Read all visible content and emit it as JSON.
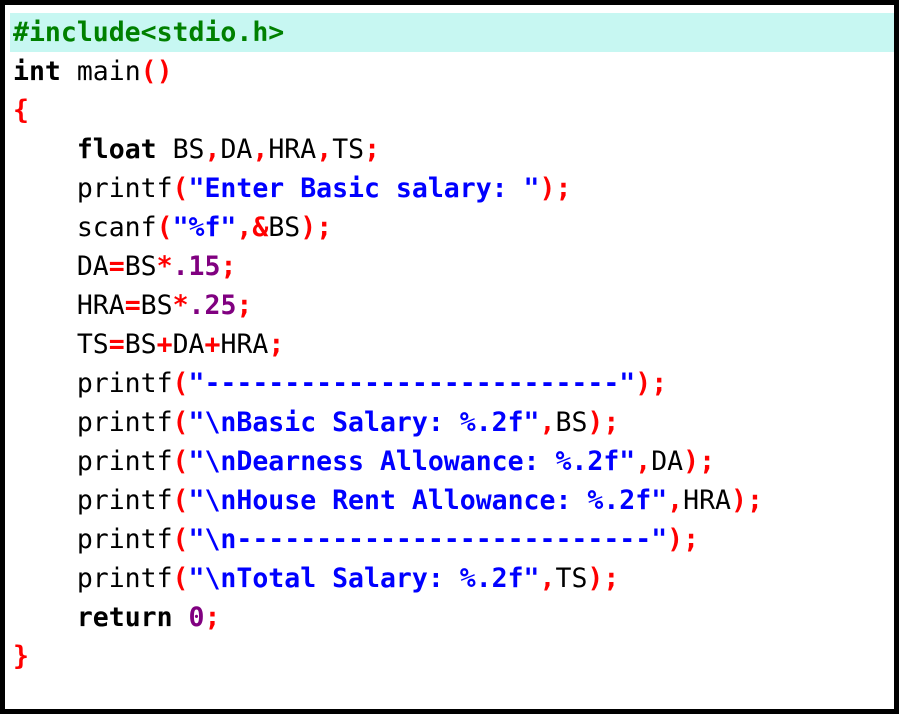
{
  "colors": {
    "plain": "#000000",
    "keyword": "#000000",
    "punct": "#ff0000",
    "string": "#0000ff",
    "number": "#800080",
    "preproc": "#008000",
    "highlight": "#c7f7f2"
  },
  "editor": {
    "highlighted_line": 0,
    "lines": [
      [
        {
          "t": "#include<stdio.h>",
          "k": "preproc"
        }
      ],
      [
        {
          "t": "int",
          "k": "keyword"
        },
        {
          "t": " main",
          "k": "plain"
        },
        {
          "t": "()",
          "k": "punct"
        }
      ],
      [
        {
          "t": "{",
          "k": "punct"
        }
      ],
      [
        {
          "t": "    ",
          "k": "plain"
        },
        {
          "t": "float",
          "k": "keyword"
        },
        {
          "t": " BS",
          "k": "plain"
        },
        {
          "t": ",",
          "k": "punct"
        },
        {
          "t": "DA",
          "k": "plain"
        },
        {
          "t": ",",
          "k": "punct"
        },
        {
          "t": "HRA",
          "k": "plain"
        },
        {
          "t": ",",
          "k": "punct"
        },
        {
          "t": "TS",
          "k": "plain"
        },
        {
          "t": ";",
          "k": "punct"
        }
      ],
      [
        {
          "t": "    printf",
          "k": "plain"
        },
        {
          "t": "(",
          "k": "punct"
        },
        {
          "t": "\"Enter Basic salary: \"",
          "k": "string"
        },
        {
          "t": ");",
          "k": "punct"
        }
      ],
      [
        {
          "t": "    scanf",
          "k": "plain"
        },
        {
          "t": "(",
          "k": "punct"
        },
        {
          "t": "\"%f\"",
          "k": "string"
        },
        {
          "t": ",&",
          "k": "punct"
        },
        {
          "t": "BS",
          "k": "plain"
        },
        {
          "t": ");",
          "k": "punct"
        }
      ],
      [
        {
          "t": "    DA",
          "k": "plain"
        },
        {
          "t": "=",
          "k": "punct"
        },
        {
          "t": "BS",
          "k": "plain"
        },
        {
          "t": "*",
          "k": "punct"
        },
        {
          "t": ".15",
          "k": "number"
        },
        {
          "t": ";",
          "k": "punct"
        }
      ],
      [
        {
          "t": "    HRA",
          "k": "plain"
        },
        {
          "t": "=",
          "k": "punct"
        },
        {
          "t": "BS",
          "k": "plain"
        },
        {
          "t": "*",
          "k": "punct"
        },
        {
          "t": ".25",
          "k": "number"
        },
        {
          "t": ";",
          "k": "punct"
        }
      ],
      [
        {
          "t": "    TS",
          "k": "plain"
        },
        {
          "t": "=",
          "k": "punct"
        },
        {
          "t": "BS",
          "k": "plain"
        },
        {
          "t": "+",
          "k": "punct"
        },
        {
          "t": "DA",
          "k": "plain"
        },
        {
          "t": "+",
          "k": "punct"
        },
        {
          "t": "HRA",
          "k": "plain"
        },
        {
          "t": ";",
          "k": "punct"
        }
      ],
      [
        {
          "t": "    printf",
          "k": "plain"
        },
        {
          "t": "(",
          "k": "punct"
        },
        {
          "t": "\"--------------------------\"",
          "k": "string"
        },
        {
          "t": ");",
          "k": "punct"
        }
      ],
      [
        {
          "t": "    printf",
          "k": "plain"
        },
        {
          "t": "(",
          "k": "punct"
        },
        {
          "t": "\"\\nBasic Salary: %.2f\"",
          "k": "string"
        },
        {
          "t": ",",
          "k": "punct"
        },
        {
          "t": "BS",
          "k": "plain"
        },
        {
          "t": ");",
          "k": "punct"
        }
      ],
      [
        {
          "t": "    printf",
          "k": "plain"
        },
        {
          "t": "(",
          "k": "punct"
        },
        {
          "t": "\"\\nDearness Allowance: %.2f\"",
          "k": "string"
        },
        {
          "t": ",",
          "k": "punct"
        },
        {
          "t": "DA",
          "k": "plain"
        },
        {
          "t": ");",
          "k": "punct"
        }
      ],
      [
        {
          "t": "    printf",
          "k": "plain"
        },
        {
          "t": "(",
          "k": "punct"
        },
        {
          "t": "\"\\nHouse Rent Allowance: %.2f\"",
          "k": "string"
        },
        {
          "t": ",",
          "k": "punct"
        },
        {
          "t": "HRA",
          "k": "plain"
        },
        {
          "t": ");",
          "k": "punct"
        }
      ],
      [
        {
          "t": "    printf",
          "k": "plain"
        },
        {
          "t": "(",
          "k": "punct"
        },
        {
          "t": "\"\\n--------------------------\"",
          "k": "string"
        },
        {
          "t": ");",
          "k": "punct"
        }
      ],
      [
        {
          "t": "    printf",
          "k": "plain"
        },
        {
          "t": "(",
          "k": "punct"
        },
        {
          "t": "\"\\nTotal Salary: %.2f\"",
          "k": "string"
        },
        {
          "t": ",",
          "k": "punct"
        },
        {
          "t": "TS",
          "k": "plain"
        },
        {
          "t": ");",
          "k": "punct"
        }
      ],
      [
        {
          "t": "    ",
          "k": "plain"
        },
        {
          "t": "return",
          "k": "keyword"
        },
        {
          "t": " ",
          "k": "plain"
        },
        {
          "t": "0",
          "k": "number"
        },
        {
          "t": ";",
          "k": "punct"
        }
      ],
      [
        {
          "t": "}",
          "k": "punct"
        }
      ]
    ]
  }
}
